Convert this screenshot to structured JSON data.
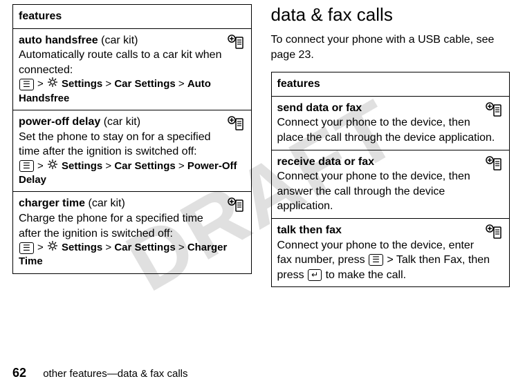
{
  "watermark": "DRAFT",
  "common": {
    "sep": " > ",
    "settings": "Settings",
    "carSettings": "Car Settings"
  },
  "left": {
    "header": "features",
    "rows": [
      {
        "title": "auto handsfree",
        "subtitle": " (car kit)",
        "desc": "Automatically route calls to a car kit when connected:",
        "leaf": "Auto Handsfree"
      },
      {
        "title": "power-off delay",
        "subtitle": " (car kit)",
        "desc": "Set the phone to stay on for a specified time after the ignition is switched off:",
        "leaf": "Power-Off Delay"
      },
      {
        "title": "charger time",
        "subtitle": " (car kit)",
        "desc": "Charge the phone for a specified time after the ignition is switched off:",
        "leaf": "Charger Time"
      }
    ]
  },
  "right": {
    "heading": "data & fax calls",
    "intro": "To connect your phone with a USB cable, see page 23.",
    "header": "features",
    "rows": [
      {
        "title": "send data or fax",
        "desc": "Connect your phone to the device, then place the call through the device application."
      },
      {
        "title": "receive data or fax",
        "desc": "Connect your phone to the device, then answer the call through the device application."
      },
      {
        "title": "talk then fax",
        "desc1": "Connect your phone to the device, enter fax number, press ",
        "leaf": "Talk then Fax",
        "desc2": ", then press ",
        "desc3": " to make the call."
      }
    ]
  },
  "footer": {
    "page": "62",
    "text": "other features—data & fax calls"
  }
}
